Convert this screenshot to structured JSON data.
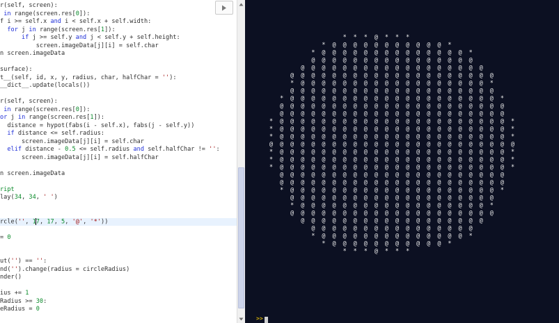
{
  "editor": {
    "run_button_icon": "play-triangle-icon",
    "current_line_index": 27,
    "caret_line_index": 27,
    "caret_col_index": 10,
    "lines": [
      [
        [
          "r(self, screen):",
          "txt"
        ]
      ],
      [
        [
          " ",
          "txt"
        ],
        [
          "in",
          "kw"
        ],
        [
          " range(screen.res[",
          "txt"
        ],
        [
          "0",
          "num"
        ],
        [
          "]):",
          "txt"
        ]
      ],
      [
        [
          "f i >= self.x ",
          "txt"
        ],
        [
          "and",
          "kw"
        ],
        [
          " i < self.x + self.width:",
          "txt"
        ]
      ],
      [
        [
          "  ",
          "txt"
        ],
        [
          "for",
          "kw"
        ],
        [
          " j ",
          "txt"
        ],
        [
          "in",
          "kw"
        ],
        [
          " range(screen.res[",
          "txt"
        ],
        [
          "1",
          "num"
        ],
        [
          "]):",
          "txt"
        ]
      ],
      [
        [
          "      ",
          "txt"
        ],
        [
          "if",
          "kw"
        ],
        [
          " j >= self.y ",
          "txt"
        ],
        [
          "and",
          "kw"
        ],
        [
          " j < self.y + self.height:",
          "txt"
        ]
      ],
      [
        [
          "          screen.imageData[j][i] = self.char",
          "txt"
        ]
      ],
      [
        [
          "n screen.imageData",
          "txt"
        ]
      ],
      [
        [
          "",
          "txt"
        ]
      ],
      [
        [
          "surface):",
          "txt"
        ]
      ],
      [
        [
          "t__(self, id, x, y, radius, char, halfChar = ",
          "txt"
        ],
        [
          "''",
          "str"
        ],
        [
          "):",
          "txt"
        ]
      ],
      [
        [
          "__dict__.update(locals())",
          "txt"
        ]
      ],
      [
        [
          "",
          "txt"
        ]
      ],
      [
        [
          "r(self, screen):",
          "txt"
        ]
      ],
      [
        [
          " ",
          "txt"
        ],
        [
          "in",
          "kw"
        ],
        [
          " range(screen.res[",
          "txt"
        ],
        [
          "0",
          "num"
        ],
        [
          "]):",
          "txt"
        ]
      ],
      [
        [
          "or",
          "kw"
        ],
        [
          " j ",
          "txt"
        ],
        [
          "in",
          "kw"
        ],
        [
          " range(screen.res[",
          "txt"
        ],
        [
          "1",
          "num"
        ],
        [
          "]):",
          "txt"
        ]
      ],
      [
        [
          "  distance = hypot(fabs(i - self.x), fabs(j - self.y))",
          "txt"
        ]
      ],
      [
        [
          "  ",
          "txt"
        ],
        [
          "if",
          "kw"
        ],
        [
          " distance <= self.radius:",
          "txt"
        ]
      ],
      [
        [
          "      screen.imageData[j][i] = self.char",
          "txt"
        ]
      ],
      [
        [
          "  ",
          "txt"
        ],
        [
          "elif",
          "kw"
        ],
        [
          " distance - ",
          "txt"
        ],
        [
          "0.5",
          "num"
        ],
        [
          " <= self.radius ",
          "txt"
        ],
        [
          "and",
          "kw"
        ],
        [
          " self.halfChar != ",
          "txt"
        ],
        [
          "''",
          "str"
        ],
        [
          ":",
          "txt"
        ]
      ],
      [
        [
          "      screen.imageData[j][i] = self.halfChar",
          "txt"
        ]
      ],
      [
        [
          "",
          "txt"
        ]
      ],
      [
        [
          "n screen.imageData",
          "txt"
        ]
      ],
      [
        [
          "",
          "txt"
        ]
      ],
      [
        [
          "ript",
          "num"
        ]
      ],
      [
        [
          "lay(",
          "txt"
        ],
        [
          "34",
          "num"
        ],
        [
          ", ",
          "txt"
        ],
        [
          "34",
          "num"
        ],
        [
          ", ",
          "txt"
        ],
        [
          "' '",
          "str"
        ],
        [
          ")",
          "txt"
        ]
      ],
      [
        [
          "",
          "txt"
        ]
      ],
      [
        [
          "",
          "txt"
        ]
      ],
      [
        [
          "rcle(",
          "txt"
        ],
        [
          "''",
          "str"
        ],
        [
          ", ",
          "txt"
        ],
        [
          "17",
          "num"
        ],
        [
          ", ",
          "txt"
        ],
        [
          "17",
          "num"
        ],
        [
          ", ",
          "txt"
        ],
        [
          "5",
          "num"
        ],
        [
          ", ",
          "txt"
        ],
        [
          "'@'",
          "str"
        ],
        [
          ", ",
          "txt"
        ],
        [
          "'*'",
          "str"
        ],
        [
          "))",
          "txt"
        ]
      ],
      [
        [
          "",
          "txt"
        ]
      ],
      [
        [
          "= ",
          "txt"
        ],
        [
          "0",
          "num"
        ]
      ],
      [
        [
          "",
          "txt"
        ]
      ],
      [
        [
          "",
          "txt"
        ]
      ],
      [
        [
          "ut(",
          "txt"
        ],
        [
          "''",
          "str"
        ],
        [
          ") == ",
          "txt"
        ],
        [
          "''",
          "str"
        ],
        [
          ":",
          "txt"
        ]
      ],
      [
        [
          "nd(",
          "txt"
        ],
        [
          "''",
          "str"
        ],
        [
          ").change(radius = circleRadius)",
          "txt"
        ]
      ],
      [
        [
          "nder()",
          "txt"
        ]
      ],
      [
        [
          "",
          "txt"
        ]
      ],
      [
        [
          "ius += ",
          "txt"
        ],
        [
          "1",
          "num"
        ]
      ],
      [
        [
          "Radius >= ",
          "txt"
        ],
        [
          "30",
          "num"
        ],
        [
          ":",
          "txt"
        ]
      ],
      [
        [
          "eRadius = ",
          "txt"
        ],
        [
          "0",
          "num"
        ]
      ]
    ]
  },
  "scrollbar": {
    "up_icon": "scroll-up-arrow-icon",
    "down_icon": "scroll-down-arrow-icon",
    "thumb_start_fraction": 0.52,
    "thumb_length_fraction": 0.46
  },
  "console": {
    "prompt": ">>",
    "cursor_icon": "text-cursor-block-icon",
    "output_lines": [
      "              * * * @ * * *",
      "          * @ @ @ @ @ @ @ @ @ @ @ *",
      "        * @ @ @ @ @ @ @ @ @ @ @ @ @ @ *",
      "        @ @ @ @ @ @ @ @ @ @ @ @ @ @ @ @",
      "      @ @ @ @ @ @ @ @ @ @ @ @ @ @ @ @ @ @",
      "    @ @ @ @ @ @ @ @ @ @ @ @ @ @ @ @ @ @ @ @",
      "    * @ @ @ @ @ @ @ @ @ @ @ @ @ @ @ @ @ @ *",
      "    @ @ @ @ @ @ @ @ @ @ @ @ @ @ @ @ @ @ @ @",
      "  * @ @ @ @ @ @ @ @ @ @ @ @ @ @ @ @ @ @ @ @ *",
      "  @ @ @ @ @ @ @ @ @ @ @ @ @ @ @ @ @ @ @ @ @ @",
      "  @ @ @ @ @ @ @ @ @ @ @ @ @ @ @ @ @ @ @ @ @ @",
      "* @ @ @ @ @ @ @ @ @ @ @ @ @ @ @ @ @ @ @ @ @ @ *",
      "* @ @ @ @ @ @ @ @ @ @ @ @ @ @ @ @ @ @ @ @ @ @ *",
      "* @ @ @ @ @ @ @ @ @ @ @ @ @ @ @ @ @ @ @ @ @ @ *",
      "@ @ @ @ @ @ @ @ @ @ @ @ @ @ @ @ @ @ @ @ @ @ @ @",
      "* @ @ @ @ @ @ @ @ @ @ @ @ @ @ @ @ @ @ @ @ @ @ *",
      "* @ @ @ @ @ @ @ @ @ @ @ @ @ @ @ @ @ @ @ @ @ @ *",
      "* @ @ @ @ @ @ @ @ @ @ @ @ @ @ @ @ @ @ @ @ @ @ *",
      "  @ @ @ @ @ @ @ @ @ @ @ @ @ @ @ @ @ @ @ @ @ @",
      "  @ @ @ @ @ @ @ @ @ @ @ @ @ @ @ @ @ @ @ @ @ @",
      "  * @ @ @ @ @ @ @ @ @ @ @ @ @ @ @ @ @ @ @ @ *",
      "    @ @ @ @ @ @ @ @ @ @ @ @ @ @ @ @ @ @ @ @",
      "    * @ @ @ @ @ @ @ @ @ @ @ @ @ @ @ @ @ @ *",
      "    @ @ @ @ @ @ @ @ @ @ @ @ @ @ @ @ @ @ @ @",
      "      @ @ @ @ @ @ @ @ @ @ @ @ @ @ @ @ @ @",
      "        @ @ @ @ @ @ @ @ @ @ @ @ @ @ @ @",
      "        * @ @ @ @ @ @ @ @ @ @ @ @ @ @ *",
      "          * @ @ @ @ @ @ @ @ @ @ @ *",
      "              * * * @ * * *"
    ]
  },
  "colors": {
    "editor_bg": "#ffffff",
    "console_bg": "#0c1022",
    "keyword": "#1f2fd8",
    "number": "#0a8a2a",
    "string": "#a01010",
    "prompt": "#ffd400"
  }
}
